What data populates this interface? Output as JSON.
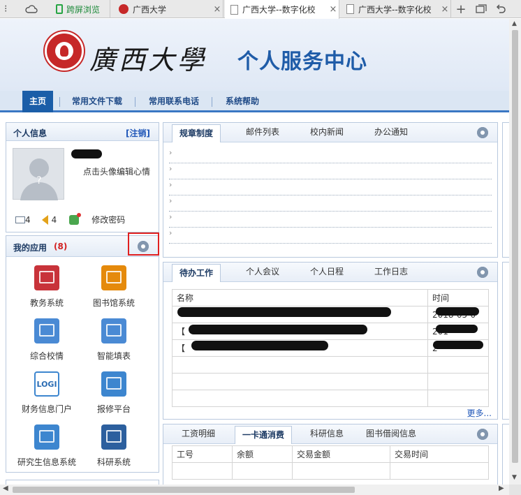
{
  "browser": {
    "tabs": [
      "跨屏浏览",
      "广西大学",
      "广西大学--数字化校",
      "广西大学--数字化校"
    ],
    "close": "×",
    "new_tab": "+"
  },
  "header": {
    "university": "廣西大學",
    "title": "个人服务中心"
  },
  "nav": [
    "主页",
    "常用文件下载",
    "常用联系电话",
    "系统帮助"
  ],
  "profile": {
    "title": "个人信息",
    "logout": "[注销]",
    "edit_hint": "点击头像编辑心情",
    "mail_count": "4",
    "sound_count": "4",
    "change_password": "修改密码"
  },
  "apps": {
    "title": "我的应用",
    "count": "(8)",
    "items": [
      {
        "label": "教务系统",
        "icon": "calendar-icon",
        "color": "#c8333a"
      },
      {
        "label": "图书馆系统",
        "icon": "books-icon",
        "color": "#e58a0c"
      },
      {
        "label": "综合校情",
        "icon": "table-chart-icon",
        "color": "#4a8ad4"
      },
      {
        "label": "智能填表",
        "icon": "form-edit-icon",
        "color": "#4a8ad4"
      },
      {
        "label": "财务信息门户",
        "icon": "logi-icon",
        "color": "#3d86cf"
      },
      {
        "label": "报修平台",
        "icon": "envelope-icon",
        "color": "#3d86cf"
      },
      {
        "label": "研究生信息系统",
        "icon": "envelope-icon",
        "color": "#3d86cf"
      },
      {
        "label": "科研系统",
        "icon": "mortarboard-icon",
        "color": "#2c5f9e"
      }
    ]
  },
  "news": {
    "tabs": [
      "规章制度",
      "邮件列表",
      "校内新闻",
      "办公通知"
    ],
    "bullet": "›"
  },
  "tasks": {
    "tabs": [
      "待办工作",
      "个人会议",
      "个人日程",
      "工作日志"
    ],
    "columns": [
      "名称",
      "时间"
    ],
    "rows": [
      {
        "name": "",
        "time": "2018-05-0"
      },
      {
        "name": "【",
        "time": "201"
      },
      {
        "name": "【",
        "time": "2"
      }
    ],
    "more": "更多..."
  },
  "finance": {
    "tabs": [
      "工资明细",
      "一卡通消费",
      "科研信息",
      "图书借阅信息"
    ],
    "columns": [
      "工号",
      "余额",
      "交易金额",
      "交易时间"
    ]
  }
}
